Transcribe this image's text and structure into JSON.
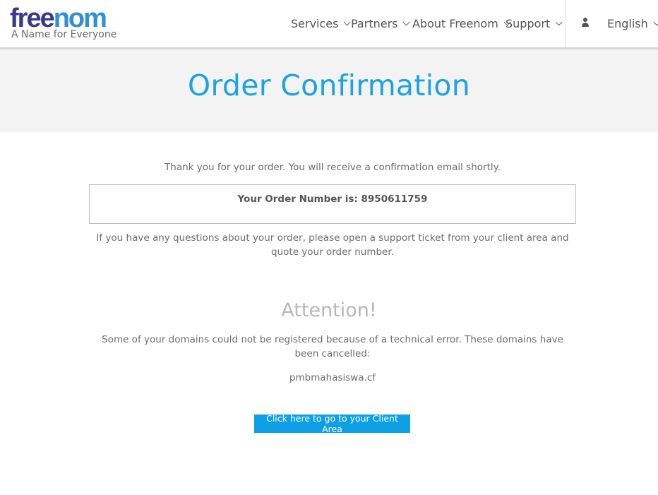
{
  "header": {
    "logo_text_part1": "free",
    "logo_text_part2": "nom",
    "tagline": "A Name for Everyone",
    "nav": [
      {
        "label": "Services"
      },
      {
        "label": "Partners"
      },
      {
        "label": "About Freenom"
      },
      {
        "label": "Support"
      }
    ],
    "language": "English",
    "icons": {
      "user": "user-icon",
      "dropdown": "chevron-down-icon"
    }
  },
  "banner": {
    "title": "Order Confirmation"
  },
  "main": {
    "thanks": "Thank you for your order. You will receive a confirmation email shortly.",
    "order_label": "Your Order Number is: 8950611759",
    "questions": "If you have any questions about your order, please open a support ticket from your client area and quote your order number.",
    "attention_title": "Attention!",
    "attention_text": "Some of your domains could not be registered because of a technical error. These domains have been cancelled:",
    "domain": "pmbmahasiswa.cf",
    "cta_label": "Click here to go to your Client Area"
  },
  "colors": {
    "accent": "#1da2e4",
    "button": "#0ea0e7",
    "logo_dark": "#3b3a8a",
    "banner_bg": "#f3f3f3"
  }
}
